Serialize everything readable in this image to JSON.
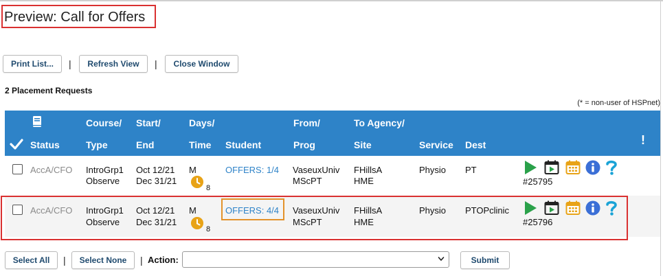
{
  "header": {
    "title": "Preview: Call for Offers"
  },
  "toolbar": {
    "print_label": "Print List...",
    "refresh_label": "Refresh View",
    "close_label": "Close Window",
    "separator": "|"
  },
  "summary": {
    "count_text": "2 Placement Requests",
    "note_text": "(* = non-user of HSPnet)"
  },
  "table": {
    "headers": {
      "status": "Status",
      "course_line1": "Course/",
      "course_line2": "Type",
      "start_line1": "Start/",
      "start_line2": "End",
      "days_line1": "Days/",
      "days_line2": "Time",
      "student": "Student",
      "from_line1": "From/",
      "from_line2": "Prog",
      "to_line1": "To Agency/",
      "to_line2": "Site",
      "service": "Service",
      "dest": "Dest",
      "alert": "!"
    },
    "rows": [
      {
        "status": "AccA/CFO",
        "course": "IntroGrp1",
        "type": "Observe",
        "start": "Oct 12/21",
        "end": "Dec 31/21",
        "days": "M",
        "time_count": "8",
        "student": "OFFERS: 1/4",
        "from": "VaseuxUniv",
        "prog": "MScPT",
        "agency": "FHillsA",
        "site": "HME",
        "service": "Physio",
        "dest": "PT",
        "ref": "#25795"
      },
      {
        "status": "AccA/CFO",
        "course": "IntroGrp1",
        "type": "Observe",
        "start": "Oct 12/21",
        "end": "Dec 31/21",
        "days": "M",
        "time_count": "8",
        "student": "OFFERS: 4/4",
        "from": "VaseuxUniv",
        "prog": "MScPT",
        "agency": "FHillsA",
        "site": "HME",
        "service": "Physio",
        "dest": "PTOPclinic",
        "ref": "#25796"
      }
    ]
  },
  "footer": {
    "select_all_label": "Select All",
    "select_none_label": "Select None",
    "separator": "|",
    "action_label": "Action:",
    "submit_label": "Submit"
  },
  "icons": [
    "play-icon",
    "play-video-icon",
    "calendar-icon",
    "info-icon",
    "help-icon",
    "clock-icon",
    "book-icon",
    "checkmark-icon"
  ],
  "colors": {
    "header_blue": "#2e83c8",
    "highlight_red": "#d93030",
    "highlight_orange": "#e3922a",
    "play_green": "#2aa14a",
    "calendar_yellow": "#e8a317",
    "info_blue": "#3b6fd6",
    "help_cyan": "#1aa3d6"
  }
}
